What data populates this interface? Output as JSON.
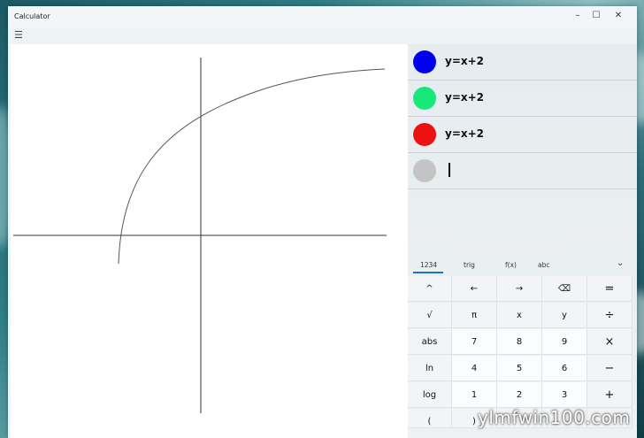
{
  "window": {
    "title": "Calculator",
    "minimize": "–",
    "maximize": "☐",
    "close": "✕"
  },
  "menu_icon": "hamburger-icon",
  "equations": [
    {
      "text": "y=x+2",
      "color": "#0000ee"
    },
    {
      "text": "y=x+2",
      "color": "#17e87a"
    },
    {
      "text": "y=x+2",
      "color": "#ee1111"
    },
    {
      "text": "",
      "color": "#c4c4c4"
    }
  ],
  "tabs": [
    {
      "label": "1234",
      "active": true
    },
    {
      "label": "trig",
      "active": false
    },
    {
      "label": "f(x)",
      "active": false
    },
    {
      "label": "abc",
      "active": false
    }
  ],
  "keys": [
    [
      "^",
      "←",
      "→",
      "⌫",
      "="
    ],
    [
      "√",
      "π",
      "x",
      "y",
      "÷"
    ],
    [
      "abs",
      "7",
      "8",
      "9",
      "×"
    ],
    [
      "ln",
      "4",
      "5",
      "6",
      "−"
    ],
    [
      "log",
      "1",
      "2",
      "3",
      "+"
    ],
    [
      "(",
      ")",
      "",
      "",
      ""
    ]
  ],
  "watermark": "ylmfwin100.com"
}
